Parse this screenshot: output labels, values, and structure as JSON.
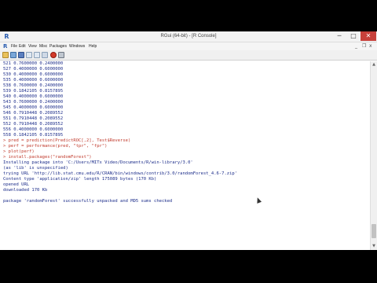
{
  "window": {
    "title": "RGui (64-bit) - [R Console]",
    "controls": {
      "minimize": "─",
      "maximize": "□",
      "close": "✕"
    }
  },
  "app_icon": "R",
  "menu": {
    "items": [
      "File",
      "Edit",
      "View",
      "Misc",
      "Packages",
      "Windows",
      "Help"
    ],
    "mdi_controls": {
      "minimize": "_",
      "restore": "❐",
      "close": "x"
    }
  },
  "toolbar": {
    "icons": [
      "open-script-icon",
      "load-workspace-icon",
      "save-workspace-icon",
      "copy-icon",
      "paste-icon",
      "copy-paste-icon",
      "stop-icon",
      "print-icon"
    ]
  },
  "console": {
    "lines": [
      {
        "text": "521 0.7600000 0.2400000",
        "type": "out"
      },
      {
        "text": "527 0.4000000 0.6000000",
        "type": "out"
      },
      {
        "text": "530 0.4000000 0.6000000",
        "type": "out"
      },
      {
        "text": "535 0.4000000 0.6000000",
        "type": "out"
      },
      {
        "text": "538 0.7600000 0.2400000",
        "type": "out"
      },
      {
        "text": "539 0.1842105 0.8157895",
        "type": "out"
      },
      {
        "text": "540 0.4000000 0.6000000",
        "type": "out"
      },
      {
        "text": "543 0.7600000 0.2400000",
        "type": "out"
      },
      {
        "text": "545 0.4000000 0.6000000",
        "type": "out"
      },
      {
        "text": "546 0.7910448 0.2089552",
        "type": "out"
      },
      {
        "text": "551 0.7910448 0.2089552",
        "type": "out"
      },
      {
        "text": "552 0.7910448 0.2089552",
        "type": "out"
      },
      {
        "text": "556 0.4000000 0.6000000",
        "type": "out"
      },
      {
        "text": "558 0.1842105 0.8157895",
        "type": "out"
      },
      {
        "text": "> pred = prediction(PredictROC[,2], Test$Reverse)",
        "type": "cmd"
      },
      {
        "text": "> perf = performance(pred, \"tpr\", \"fpr\")",
        "type": "cmd"
      },
      {
        "text": "> plot(perf)",
        "type": "cmd"
      },
      {
        "text": "> install.packages(\"randomForest\")",
        "type": "cmd"
      },
      {
        "text": "Installing package into 'C:/Users/MITx Video/Documents/R/win-library/3.0'",
        "type": "out"
      },
      {
        "text": "(as 'lib' is unspecified)",
        "type": "out"
      },
      {
        "text": "trying URL 'http://lib.stat.cmu.edu/R/CRAN/bin/windows/contrib/3.0/randomForest_4.6-7.zip'",
        "type": "out"
      },
      {
        "text": "Content type 'application/zip' length 175089 bytes (170 Kb)",
        "type": "out"
      },
      {
        "text": "opened URL",
        "type": "out"
      },
      {
        "text": "downloaded 170 Kb",
        "type": "out"
      },
      {
        "text": "",
        "type": "blank"
      },
      {
        "text": "package 'randomForest' successfully unpacked and MD5 sums checked",
        "type": "out"
      }
    ]
  },
  "scrollbar": {
    "up_arrow": "▲",
    "down_arrow": "▼",
    "position_fraction": 0.92
  },
  "colors": {
    "output_text": "#1c2d8a",
    "command_text": "#c0392b",
    "close_button": "#c7403a"
  }
}
